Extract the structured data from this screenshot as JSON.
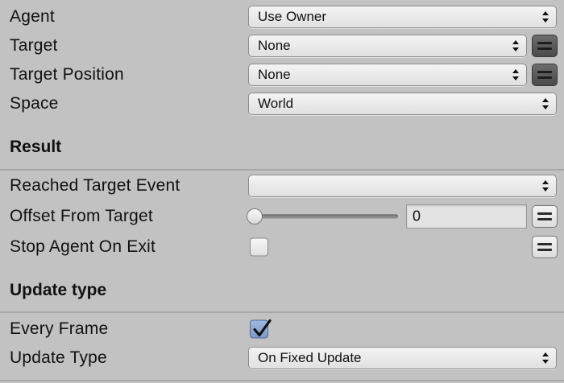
{
  "fields_top": {
    "agent": {
      "label": "Agent",
      "value": "Use Owner"
    },
    "target": {
      "label": "Target",
      "value": "None"
    },
    "target_position": {
      "label": "Target Position",
      "value": "None"
    },
    "space": {
      "label": "Space",
      "value": "World"
    }
  },
  "result": {
    "title": "Result",
    "reached_target_event": {
      "label": "Reached Target Event",
      "value": ""
    },
    "offset_from_target": {
      "label": "Offset From Target",
      "value": "0",
      "slider_fraction": 0.0
    },
    "stop_agent_on_exit": {
      "label": "Stop Agent On Exit",
      "checked": false
    }
  },
  "update": {
    "title": "Update type",
    "every_frame": {
      "label": "Every Frame",
      "checked": true
    },
    "update_type": {
      "label": "Update Type",
      "value": "On Fixed Update"
    }
  },
  "icons": {
    "dropdown_arrows": "updown-arrows-icon",
    "variable_toggle": "equals-icon",
    "checkmark": "checkmark-icon"
  },
  "colors": {
    "background": "#c2c2c2",
    "checkbox_checked": "#8aa6d4",
    "variable_button_active": "#5a5a5a"
  }
}
